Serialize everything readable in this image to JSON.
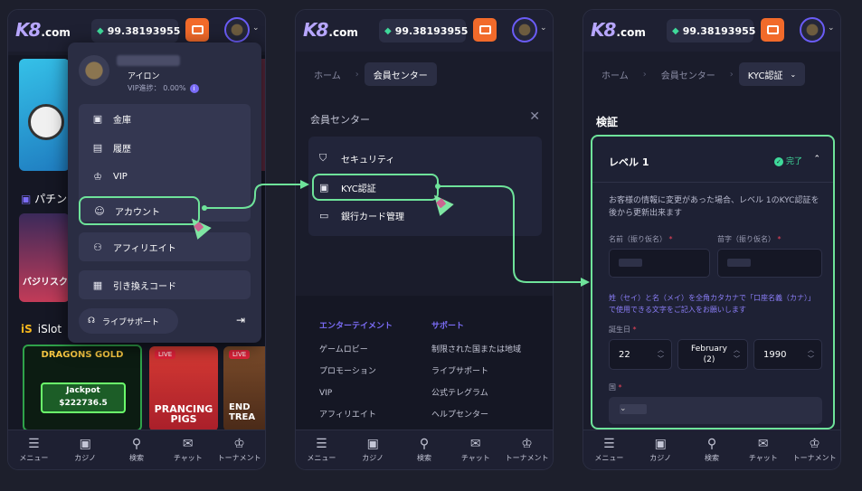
{
  "colors": {
    "accent": "#6ee39a",
    "brand": "#7b6cf6",
    "wallet": "#f26a2a",
    "success": "#3fd99a",
    "required": "#f0445a"
  },
  "header": {
    "logo": "K8",
    "logo_suffix": ".com",
    "balance": "99.38193955",
    "gem_icon": "diamond-icon"
  },
  "bottom_nav": [
    "メニュー",
    "カジノ",
    "検索",
    "チャット",
    "トーナメント"
  ],
  "panel1": {
    "section_pachi": "パチン",
    "slot_card_title": "バジリスク",
    "section_islot": "iSlot",
    "game1_title": "DRAGONS GOLD",
    "game1_jackpot_label": "Jackpot",
    "game1_jackpot_value": "$222736.5",
    "game2_live": "LIVE",
    "game2_title": "PRANCING PIGS",
    "game3_live": "LIVE",
    "game3_title": "END TREA",
    "menu": {
      "user_level": "アイロン",
      "vip_label": "VIP進捗：",
      "vip_value": "0.00%",
      "items_group": [
        "金庫",
        "履歴",
        "VIP"
      ],
      "account": "アカウント",
      "affiliate": "アフィリエイト",
      "redeem": "引き換えコード",
      "live_support": "ライブサポート"
    }
  },
  "panel2": {
    "breadcrumb": [
      "ホーム",
      "会員センター"
    ],
    "section_title": "会員センター",
    "items": [
      "セキュリティ",
      "KYC認証",
      "銀行カード管理"
    ],
    "footer": {
      "col1_title": "エンターテイメント",
      "col1": [
        "ゲームロビー",
        "プロモーション",
        "VIP",
        "アフィリエイト"
      ],
      "col2_title": "サポート",
      "col2": [
        "制限された国または地域",
        "ライブサポート",
        "公式テレグラム",
        "ヘルプセンター"
      ]
    }
  },
  "panel3": {
    "breadcrumb": [
      "ホーム",
      "会員センター",
      "KYC認証"
    ],
    "title": "検証",
    "level": "レベル 1",
    "status": "完了",
    "desc": "お客様の情報に変更があった場合、レベル 1のKYC認証を後から更新出来ます",
    "first_name_label": "名前（振り仮名）",
    "last_name_label": "苗字（振り仮名）",
    "kana_note": "姓（セイ）と名（メイ）を全角カタカナで「口座名義（カナ）」で使用できる文字をご記入をお願いします",
    "dob_label": "誕生日",
    "dob_day": "22",
    "dob_month": "February (2)",
    "dob_year": "1990",
    "country_label": "国",
    "required_mark": "*"
  }
}
